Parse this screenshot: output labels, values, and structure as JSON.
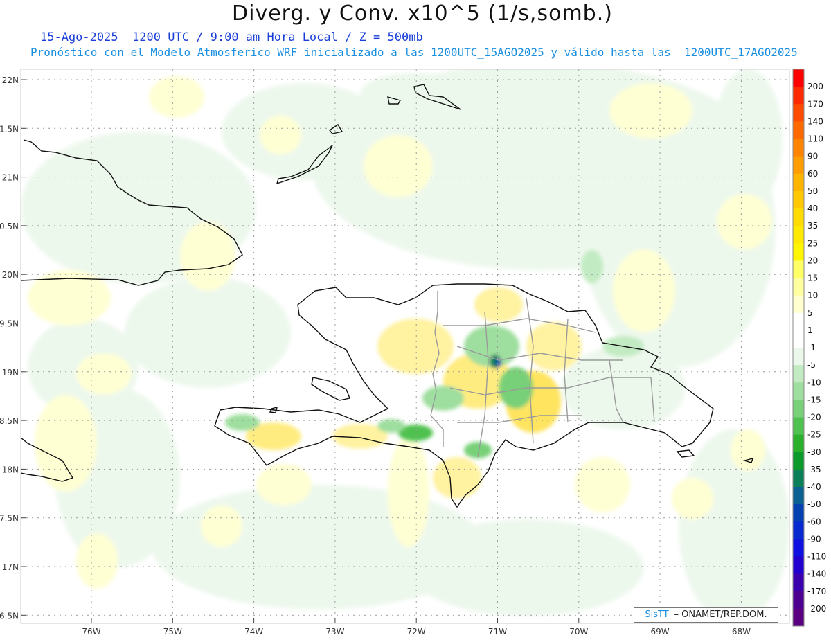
{
  "header": {
    "title": "Diverg. y Conv. x10^5 (1/s,somb.)",
    "subtitle1": "15-Ago-2025  1200 UTC / 9:00 am Hora Local / Z = 500mb",
    "subtitle2": "Pronóstico con el Modelo Atmosferico WRF inicializado a las 1200UTC_15AGO2025 y válido hasta las  1200UTC_17AGO2025"
  },
  "credit": {
    "brand": "SisTT",
    "org": "– ONAMET/REP.DOM."
  },
  "map": {
    "lat_labels": [
      "22N",
      "1.5N",
      "21N",
      "0.5N",
      "20N",
      "9.5N",
      "19N",
      "8.5N",
      "18N",
      "7.5N",
      "17N",
      "6.5N"
    ],
    "lon_labels": [
      "76W",
      "75W",
      "74W",
      "73W",
      "72W",
      "71W",
      "70W",
      "69W",
      "68W"
    ]
  },
  "legend": {
    "labels": [
      "200",
      "170",
      "140",
      "110",
      "90",
      "60",
      "50",
      "40",
      "35",
      "25",
      "20",
      "15",
      "10",
      "5",
      "1",
      "-1",
      "-5",
      "-10",
      "-15",
      "-20",
      "-25",
      "-30",
      "-35",
      "-40",
      "-50",
      "-60",
      "-90",
      "-110",
      "-140",
      "-170",
      "-200"
    ],
    "colors": [
      "#ff0000",
      "#ff2a00",
      "#ff4b00",
      "#ff6a00",
      "#ff8400",
      "#ff9c00",
      "#ffb400",
      "#ffc800",
      "#ffdc00",
      "#ffe900",
      "#fff500",
      "#ffff66",
      "#ffffa0",
      "#ffffd0",
      "#ffffff",
      "#ffffff",
      "#eaf7ea",
      "#c3ebc3",
      "#9ede9e",
      "#78d078",
      "#4fc14f",
      "#2ab02a",
      "#0c9a2a",
      "#0a7f5a",
      "#0a6090",
      "#0540b0",
      "#0828d0",
      "#1010e0",
      "#2200d0",
      "#3a00b0",
      "#4e0090",
      "#5a0080"
    ]
  }
}
